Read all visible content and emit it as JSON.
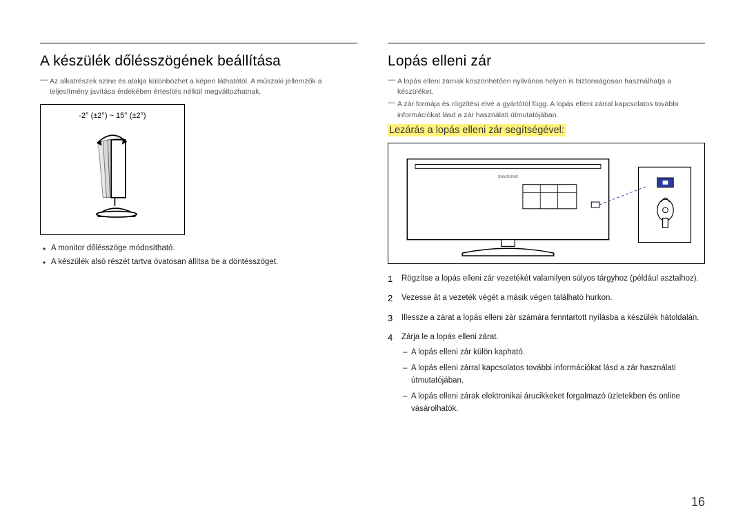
{
  "left": {
    "title": "A készülék dőlésszögének beállítása",
    "note1": "Az alkatrészek színe és alakja különbözhet a képen láthatótól. A műszaki jellemzők a teljesítmény javítása érdekében értesítés nélkül megváltozhatnak.",
    "tilt_caption": "-2° (±2°) ~ 15° (±2°)",
    "bullets": [
      "A monitor dőlésszöge módosítható.",
      "A készülék alsó részét tartva óvatosan állítsa be a döntésszöget."
    ]
  },
  "right": {
    "title": "Lopás elleni zár",
    "note1": "A lopás elleni zárnak köszönhetően nyilvános helyen is biztonságosan használhatja a készüléket.",
    "note2": "A zár formája és rögzítési elve a gyártótól függ. A lopás elleni zárral kapcsolatos további információkat lásd a zár használati útmutatójában.",
    "subheading": "Lezárás a lopás elleni zár segítségével:",
    "steps": [
      {
        "n": "1",
        "t": "Rögzítse a lopás elleni zár vezetékét valamilyen súlyos tárgyhoz (például asztalhoz)."
      },
      {
        "n": "2",
        "t": "Vezesse át a vezeték végét a másik végen található hurkon."
      },
      {
        "n": "3",
        "t": "Illessze a zárat a lopás elleni zár számára fenntartott nyílásba a készülék hátoldalán."
      },
      {
        "n": "4",
        "t": "Zárja le a lopás elleni zárat."
      }
    ],
    "substeps": [
      "A lopás elleni zár külön kapható.",
      "A lopás elleni zárral kapcsolatos további információkat lásd a zár használati útmutatójában.",
      "A lopás elleni zárak elektronikai árucikkeket forgalmazó üzletekben és online vásárolhatók."
    ]
  },
  "page_number": "16"
}
